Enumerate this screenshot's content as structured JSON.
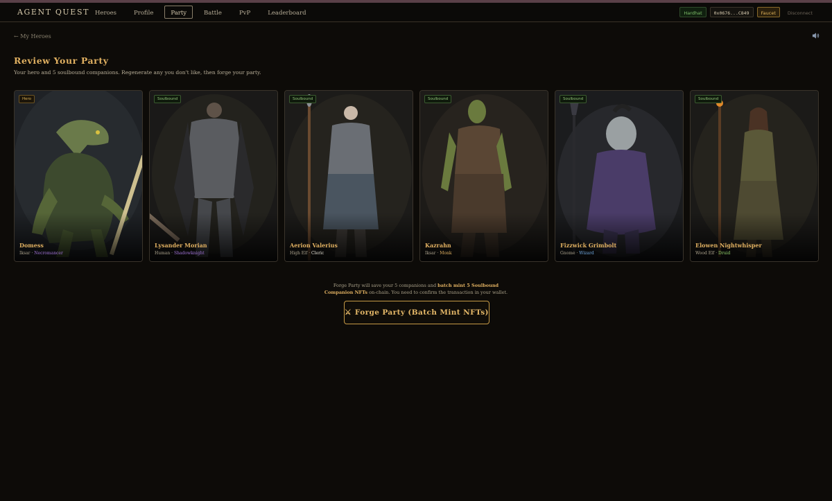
{
  "app": {
    "brand": "AGENT QUEST"
  },
  "nav": {
    "items": [
      {
        "label": "Heroes",
        "active": false
      },
      {
        "label": "Profile",
        "active": false
      },
      {
        "label": "Party",
        "active": true
      },
      {
        "label": "Battle",
        "active": false
      },
      {
        "label": "PvP",
        "active": false
      },
      {
        "label": "Leaderboard",
        "active": false
      }
    ]
  },
  "wallet": {
    "network": "Hardhat",
    "address": "0x0676...C849",
    "faucet": "Faucet",
    "disconnect": "Disconnect"
  },
  "page": {
    "back_label": "My Heroes",
    "back_icon": "←",
    "title": "Review Your Party",
    "subtitle": "Your hero and 5 soulbound companions. Regenerate any you don't like, then forge your party."
  },
  "cards": [
    {
      "badge": "Hero",
      "name": "Domess",
      "race": "Iksar",
      "class": "Necromancer",
      "class_color": "#a274d8"
    },
    {
      "badge": "Soulbound",
      "name": "Lysander Morian",
      "race": "Human",
      "class": "Shadowknight",
      "class_color": "#a274d8"
    },
    {
      "badge": "Soulbound",
      "name": "Aerion Valerius",
      "race": "High Elf",
      "class": "Cleric",
      "class_color": "#e6e2d6"
    },
    {
      "badge": "Soulbound",
      "name": "Kazrahn",
      "race": "Iksar",
      "class": "Monk",
      "class_color": "#e0b061"
    },
    {
      "badge": "Soulbound",
      "name": "Fizzwick Grimbolt",
      "race": "Gnome",
      "class": "Wizard",
      "class_color": "#6fa8e0"
    },
    {
      "badge": "Soulbound",
      "name": "Elowen Nightwhisper",
      "race": "Wood Elf",
      "class": "Druid",
      "class_color": "#8fcf6a"
    }
  ],
  "forge": {
    "note_prefix": "Forge Party will save your 5 companions and ",
    "note_bold": "batch mint 5 Soulbound Companion NFTs",
    "note_suffix": " on-chain. You need to confirm the transaction in your wallet.",
    "button_icon": "⚔",
    "button_label": "Forge Party (Batch Mint NFTs)"
  },
  "colors": {
    "accent": "#e0b061",
    "background": "#0d0b08",
    "soulbound_badge": "#93c47a"
  }
}
